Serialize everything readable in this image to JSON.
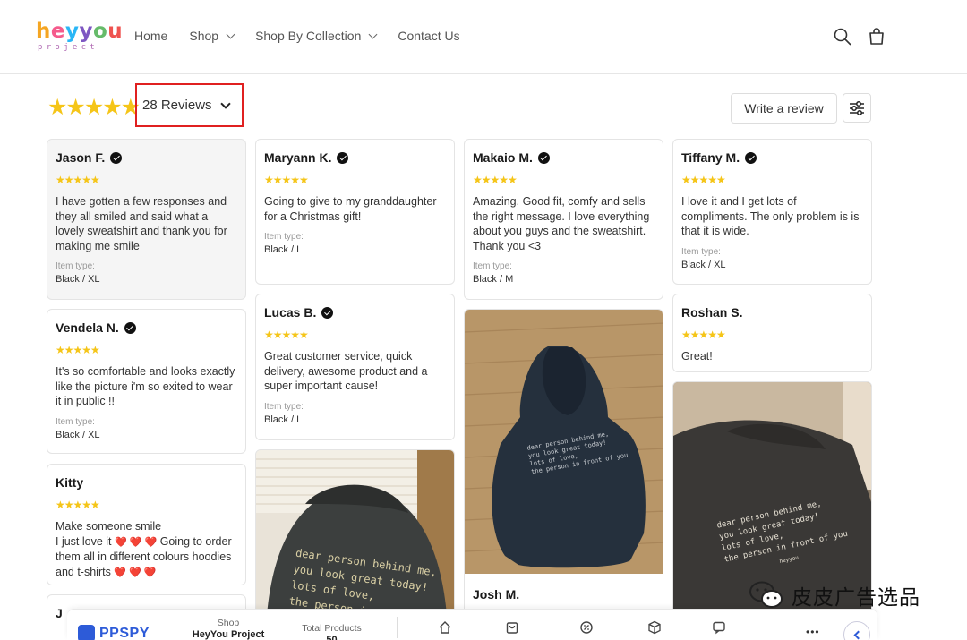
{
  "header": {
    "logo_main": "heyyou",
    "logo_sub": "project",
    "nav": [
      {
        "label": "Home",
        "has_dropdown": false
      },
      {
        "label": "Shop",
        "has_dropdown": true
      },
      {
        "label": "Shop By Collection",
        "has_dropdown": true
      },
      {
        "label": "Contact Us",
        "has_dropdown": false
      }
    ],
    "icons": [
      "search-icon",
      "cart-icon"
    ]
  },
  "summary": {
    "rating_stars": "★★★★★",
    "reviews_label": "28 Reviews",
    "write_review": "Write a review"
  },
  "colors": {
    "star": "#f5c518",
    "highlight_box": "#e02020",
    "brand_blue": "#2d5bd8"
  },
  "reviews": [
    {
      "name": "Jason F.",
      "verified": true,
      "stars": "★★★★★",
      "body": "I have gotten a few responses and they all smiled and said what a lovely sweatshirt and thank you for making me smile",
      "item_label": "Item type:",
      "item_value": "Black / XL"
    },
    {
      "name": "Maryann K.",
      "verified": true,
      "stars": "★★★★★",
      "body": "Going to give to my granddaughter for a Christmas gift!",
      "item_label": "Item type:",
      "item_value": "Black / L"
    },
    {
      "name": "Makaio M.",
      "verified": true,
      "stars": "★★★★★",
      "body": "Amazing. Good fit, comfy and sells the right message. I love everything about you guys and the sweatshirt. Thank you <3",
      "item_label": "Item type:",
      "item_value": "Black / M"
    },
    {
      "name": "Tiffany M.",
      "verified": true,
      "stars": "★★★★★",
      "body": "I love it and I get lots of compliments. The only problem is is that it is wide.",
      "item_label": "Item type:",
      "item_value": "Black / XL"
    },
    {
      "name": "Vendela N.",
      "verified": true,
      "stars": "★★★★★",
      "body": "It's so comfortable and looks exactly like the picture i'm so exited to wear it in public !!",
      "item_label": "Item type:",
      "item_value": "Black / XL"
    },
    {
      "name": "Lucas B.",
      "verified": true,
      "stars": "★★★★★",
      "body": "Great customer service, quick delivery, awesome product and a super important cause!",
      "item_label": "Item type:",
      "item_value": "Black / L"
    },
    {
      "name": "Roshan S.",
      "verified": false,
      "stars": "★★★★★",
      "body": "Great!"
    },
    {
      "name": "Kitty",
      "verified": false,
      "stars": "★★★★★",
      "body_line1": "Make someone smile",
      "body_line2a": "I just love it",
      "hearts": "❤️ ❤️ ❤️",
      "body_line2b": "Going to order them all in different colours hoodies and t-shirts",
      "hearts_end": "❤️ ❤️ ❤️"
    },
    {
      "name": "Josh M."
    },
    {
      "name": "J"
    }
  ],
  "photos": {
    "hoodie_text_lines": [
      "dear person behind me,",
      "you look great today!",
      "lots of love,",
      "the person in front of you"
    ],
    "hoodie_tag": "heyyou"
  },
  "ext_bar": {
    "brand": "PPSPY",
    "shop_label": "Shop",
    "shop_value": "HeyYou Project",
    "total_label": "Total Products",
    "total_value": "50"
  },
  "watermark": "皮皮广告选品"
}
